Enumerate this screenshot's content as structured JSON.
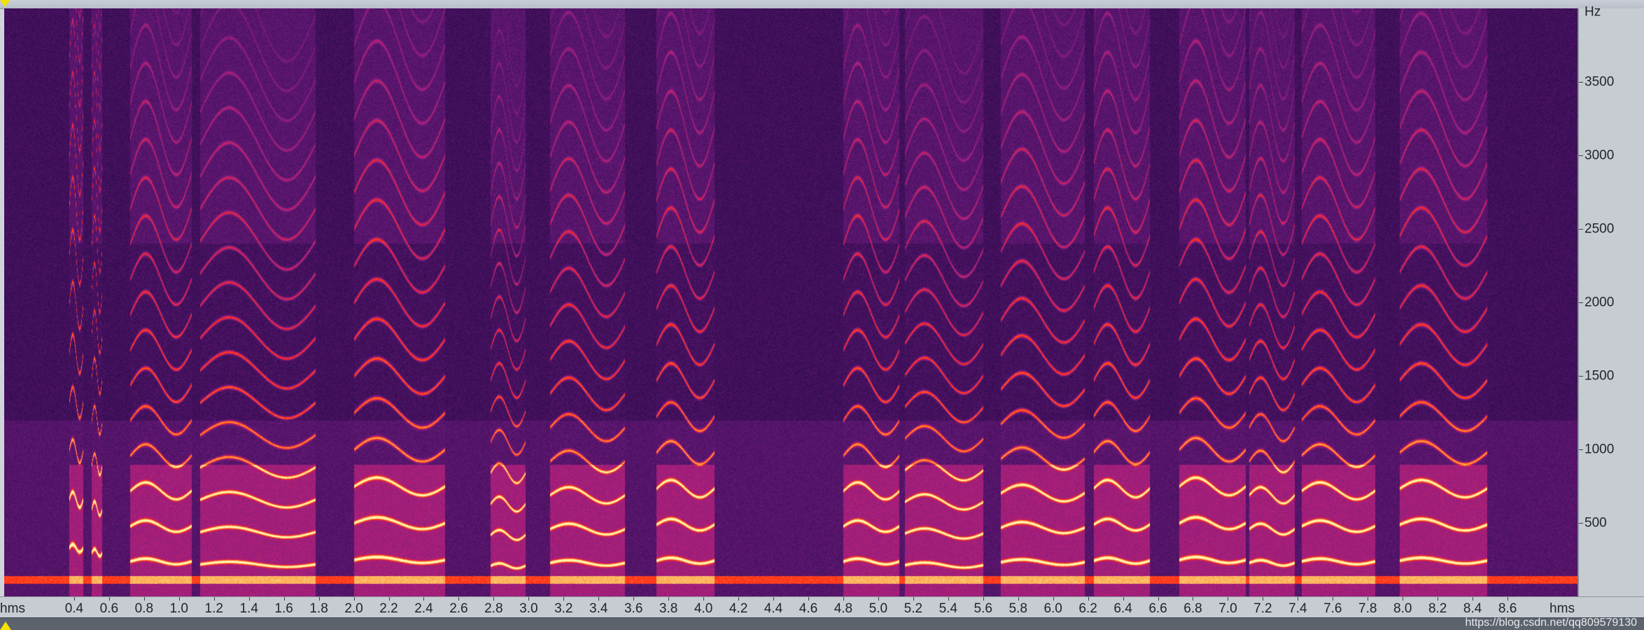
{
  "chart_data": {
    "type": "heatmap",
    "title": "",
    "xlabel": "hms",
    "ylabel": "Hz",
    "xlim": [
      0.0,
      9.0
    ],
    "ylim": [
      0,
      4000
    ],
    "x_ticks": [
      "0.4",
      "0.6",
      "0.8",
      "1.0",
      "1.2",
      "1.4",
      "1.6",
      "1.8",
      "2.0",
      "2.2",
      "2.4",
      "2.6",
      "2.8",
      "3.0",
      "3.2",
      "3.4",
      "3.6",
      "3.8",
      "4.0",
      "4.2",
      "4.4",
      "4.6",
      "4.8",
      "5.0",
      "5.2",
      "5.4",
      "5.6",
      "5.8",
      "6.0",
      "6.2",
      "6.4",
      "6.6",
      "6.8",
      "7.0",
      "7.2",
      "7.4",
      "7.6",
      "7.8",
      "8.0",
      "8.2",
      "8.4",
      "8.6"
    ],
    "y_ticks": [
      "500",
      "1000",
      "1500",
      "2000",
      "2500",
      "3000",
      "3500"
    ],
    "colormap": [
      "#05020f",
      "#2a0b4a",
      "#6b1a7a",
      "#b0207a",
      "#ff2a16",
      "#ff9a3a",
      "#fff3b0"
    ],
    "voiced_segments": [
      {
        "start": 0.37,
        "end": 0.45,
        "f0": 330
      },
      {
        "start": 0.5,
        "end": 0.56,
        "f0": 300
      },
      {
        "start": 0.72,
        "end": 1.07,
        "f0": 240
      },
      {
        "start": 1.12,
        "end": 1.78,
        "f0": 220
      },
      {
        "start": 2.0,
        "end": 2.52,
        "f0": 250
      },
      {
        "start": 2.78,
        "end": 2.98,
        "f0": 210
      },
      {
        "start": 3.12,
        "end": 3.55,
        "f0": 230
      },
      {
        "start": 3.73,
        "end": 4.06,
        "f0": 245
      },
      {
        "start": 4.8,
        "end": 5.12,
        "f0": 240
      },
      {
        "start": 5.15,
        "end": 5.6,
        "f0": 215
      },
      {
        "start": 5.7,
        "end": 6.18,
        "f0": 235
      },
      {
        "start": 6.23,
        "end": 6.55,
        "f0": 245
      },
      {
        "start": 6.72,
        "end": 7.1,
        "f0": 250
      },
      {
        "start": 7.12,
        "end": 7.38,
        "f0": 230
      },
      {
        "start": 7.42,
        "end": 7.84,
        "f0": 240
      },
      {
        "start": 7.98,
        "end": 8.48,
        "f0": 245
      }
    ]
  },
  "axis": {
    "time_start_label": "hms",
    "time_end_label": "hms",
    "freq_unit": "Hz"
  },
  "watermark": "https://blog.csdn.net/qq809579130"
}
